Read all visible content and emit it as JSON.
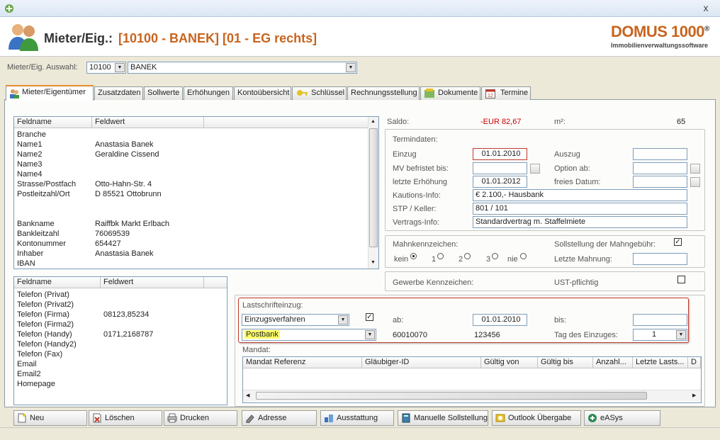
{
  "window": {
    "close_glyph": "x"
  },
  "header": {
    "title_prefix": "Mieter/Eig.:",
    "title_record": "[10100 - BANEK] [01 - EG rechts]",
    "brand_name": "DOMUS 1000",
    "brand_mark": "®",
    "brand_sub": "Immobilienverwaltungssoftware"
  },
  "selection": {
    "label": "Mieter/Eig. Auswahl:",
    "id_value": "10100",
    "name_value": "BANEK"
  },
  "tabs": [
    {
      "label": "Mieter/Eigentümer",
      "icon": "people-icon"
    },
    {
      "label": "Zusatzdaten"
    },
    {
      "label": "Sollwerte"
    },
    {
      "label": "Erhöhungen"
    },
    {
      "label": "Kontoübersicht"
    },
    {
      "label": "Schlüssel",
      "icon": "key-icon"
    },
    {
      "label": "Rechnungsstellung"
    },
    {
      "label": "Dokumente",
      "icon": "documents-icon"
    },
    {
      "label": "Termine",
      "icon": "calendar-icon"
    }
  ],
  "grid1": {
    "col_fieldname": "Feldname",
    "col_fieldvalue": "Feldwert",
    "rows": [
      {
        "name": "Branche",
        "value": ""
      },
      {
        "name": "Name1",
        "value": "Anastasia Banek"
      },
      {
        "name": "Name2",
        "value": "Geraldine Cissend"
      },
      {
        "name": "Name3",
        "value": ""
      },
      {
        "name": "Name4",
        "value": ""
      },
      {
        "name": "Strasse/Postfach",
        "value": "Otto-Hahn-Str. 4"
      },
      {
        "name": "Postleitzahl/Ort",
        "value": "D 85521 Ottobrunn"
      },
      {
        "name": "",
        "value": ""
      },
      {
        "name": "",
        "value": ""
      },
      {
        "name": "Bankname",
        "value": "Raiffbk Markt Erlbach"
      },
      {
        "name": "Bankleitzahl",
        "value": "76069539"
      },
      {
        "name": "Kontonummer",
        "value": "654427"
      },
      {
        "name": "Inhaber",
        "value": "Anastasia Banek"
      },
      {
        "name": "IBAN",
        "value": ""
      }
    ]
  },
  "grid2": {
    "col_fieldname": "Feldname",
    "col_fieldvalue": "Feldwert",
    "rows": [
      {
        "name": "Telefon (Privat)",
        "value": ""
      },
      {
        "name": "Telefon (Privat2)",
        "value": ""
      },
      {
        "name": "Telefon (Firma)",
        "value": "08123,85234"
      },
      {
        "name": "Telefon (Firma2)",
        "value": ""
      },
      {
        "name": "Telefon (Handy)",
        "value": "0171,2168787"
      },
      {
        "name": "Telefon (Handy2)",
        "value": ""
      },
      {
        "name": "Telefon (Fax)",
        "value": ""
      },
      {
        "name": "Email",
        "value": ""
      },
      {
        "name": "Email2",
        "value": ""
      },
      {
        "name": "Homepage",
        "value": ""
      }
    ]
  },
  "saldo": {
    "label": "Saldo:",
    "value": "-EUR 82,67",
    "value_color": "#cc0000",
    "m2_label": "m²:",
    "m2_value": "65"
  },
  "termindaten": {
    "title": "Termindaten:",
    "einzug_label": "Einzug",
    "einzug_value": "01.01.2010",
    "auszug_label": "Auszug",
    "auszug_value": "",
    "mv_label": "MV befristet bis:",
    "mv_value": "",
    "option_label": "Option ab:",
    "option_value": "",
    "erhoehung_label": "letzte Erhöhung",
    "erhoehung_value": "01.01.2012",
    "freies_label": "freies Datum:",
    "freies_value": "",
    "kaution_label": "Kautions-Info:",
    "kaution_value": "€ 2.100,- Hausbank",
    "stp_label": "STP / Keller:",
    "stp_value": "801 / 101",
    "vertrag_label": "Vertrags-Info:",
    "vertrag_value": "Standardvertrag m. Staffelmiete"
  },
  "mahn": {
    "title": "Mahnkennzeichen:",
    "opt_kein": "kein",
    "opt_1": "1",
    "opt_2": "2",
    "opt_3": "3",
    "opt_nie": "nie",
    "sollstellung_label": "Sollstellung der Mahngebühr:",
    "sollstellung_checked": "✓",
    "letzte_label": "Letzte Mahnung:",
    "letzte_value": ""
  },
  "gewerbe": {
    "label": "Gewerbe Kennzeichen:",
    "ust_label": "UST-pflichtig"
  },
  "lastschrift": {
    "title": "Lastschrifteinzug:",
    "verfahren_value": "Einzugsverfahren",
    "checked": "✓",
    "ab_label": "ab:",
    "ab_value": "01.01.2010",
    "bis_label": "bis:",
    "bis_value": "",
    "bank_value": "Postbank",
    "blz_value": "60010070",
    "konto_value": "123456",
    "tag_label": "Tag des Einzuges:",
    "tag_value": "1"
  },
  "mandat": {
    "title": "Mandat:",
    "columns": [
      "Mandat Referenz",
      "Gläubiger-ID",
      "Gültig von",
      "Gültig bis",
      "Anzahl...",
      "Letzte Lasts...",
      "D"
    ]
  },
  "buttons": [
    {
      "label": "Neu",
      "icon": "new-document-icon"
    },
    {
      "label": "Löschen",
      "icon": "delete-icon"
    },
    {
      "label": "Drucken",
      "icon": "printer-icon"
    },
    {
      "label": "Adresse",
      "icon": "address-icon"
    },
    {
      "label": "Ausstattung",
      "icon": "equipment-icon"
    },
    {
      "label": "Manuelle Sollstellung",
      "icon": "calculator-icon"
    },
    {
      "label": "Outlook Übergabe",
      "icon": "outlook-icon"
    },
    {
      "label": "eASys",
      "icon": "easys-icon"
    }
  ]
}
